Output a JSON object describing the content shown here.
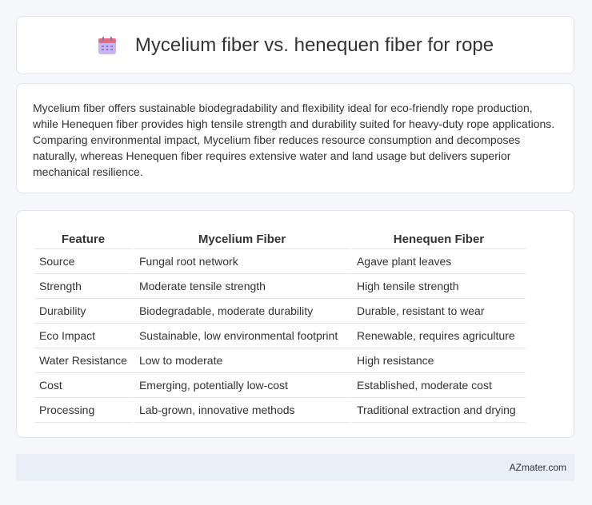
{
  "header": {
    "title": "Mycelium fiber vs. henequen fiber for rope",
    "icon": "calendar-icon",
    "icon_colors": {
      "top": "#e66b7d",
      "body": "#c9b6f0",
      "dots": "#8f7ad8"
    }
  },
  "description": "Mycelium fiber offers sustainable biodegradability and flexibility ideal for eco-friendly rope production, while Henequen fiber provides high tensile strength and durability suited for heavy-duty rope applications. Comparing environmental impact, Mycelium fiber reduces resource consumption and decomposes naturally, whereas Henequen fiber requires extensive water and land usage but delivers superior mechanical resilience.",
  "table": {
    "headers": [
      "Feature",
      "Mycelium Fiber",
      "Henequen Fiber"
    ],
    "rows": [
      [
        "Source",
        "Fungal root network",
        "Agave plant leaves"
      ],
      [
        "Strength",
        "Moderate tensile strength",
        "High tensile strength"
      ],
      [
        "Durability",
        "Biodegradable, moderate durability",
        "Durable, resistant to wear"
      ],
      [
        "Eco Impact",
        "Sustainable, low environmental footprint",
        "Renewable, requires agriculture"
      ],
      [
        "Water Resistance",
        "Low to moderate",
        "High resistance"
      ],
      [
        "Cost",
        "Emerging, potentially low-cost",
        "Established, moderate cost"
      ],
      [
        "Processing",
        "Lab-grown, innovative methods",
        "Traditional extraction and drying"
      ]
    ]
  },
  "footer": {
    "brand": "AZmater.com"
  }
}
